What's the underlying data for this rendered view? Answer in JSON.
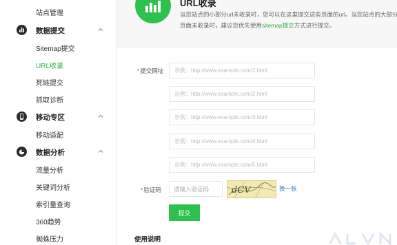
{
  "sidebar": {
    "top_item": "站点管理",
    "sections": [
      {
        "label": "数据提交",
        "icon": "bar-chart-icon",
        "items": [
          {
            "label": "Sitemap提交",
            "active": false
          },
          {
            "label": "URL收录",
            "active": true
          },
          {
            "label": "死链提交",
            "active": false
          },
          {
            "label": "抓取诊断",
            "active": false
          }
        ]
      },
      {
        "label": "移动专区",
        "icon": "mobile-icon",
        "items": [
          {
            "label": "移动适配",
            "active": false
          }
        ]
      },
      {
        "label": "数据分析",
        "icon": "pie-chart-icon",
        "items": [
          {
            "label": "流量分析",
            "active": false
          },
          {
            "label": "关键词分析",
            "active": false
          },
          {
            "label": "索引量查询",
            "active": false
          },
          {
            "label": "360趋势",
            "active": false
          },
          {
            "label": "蜘蛛压力",
            "active": false
          }
        ]
      }
    ]
  },
  "header": {
    "title": "URL收录",
    "desc_before": "当您站点的小部分url未收录时，您可以在这里提交这些页面的url。当您站点的大部分页面未收录时，建议您优先使用",
    "desc_link": "sitemap提交",
    "desc_after": "方式进行提交。"
  },
  "form": {
    "url_label": "提交网址",
    "required_mark": "*",
    "url_placeholders": [
      "示例：http://www.example.com/1.html",
      "示例：http://www.example.com/2.html",
      "示例：http://www.example.com/3.html",
      "示例：http://www.example.com/4.html",
      "示例：http://www.example.com/5.html"
    ],
    "captcha_label": "验证码",
    "captcha_placeholder": "请输入验证码",
    "captcha_text": "dCV",
    "refresh_link": "换一张",
    "submit_label": "提交"
  },
  "usage": {
    "title": "使用说明"
  },
  "colors": {
    "accent": "#2ec14e",
    "active_text": "#2fae4a",
    "link": "#2a7ac9",
    "required": "#e33333"
  }
}
